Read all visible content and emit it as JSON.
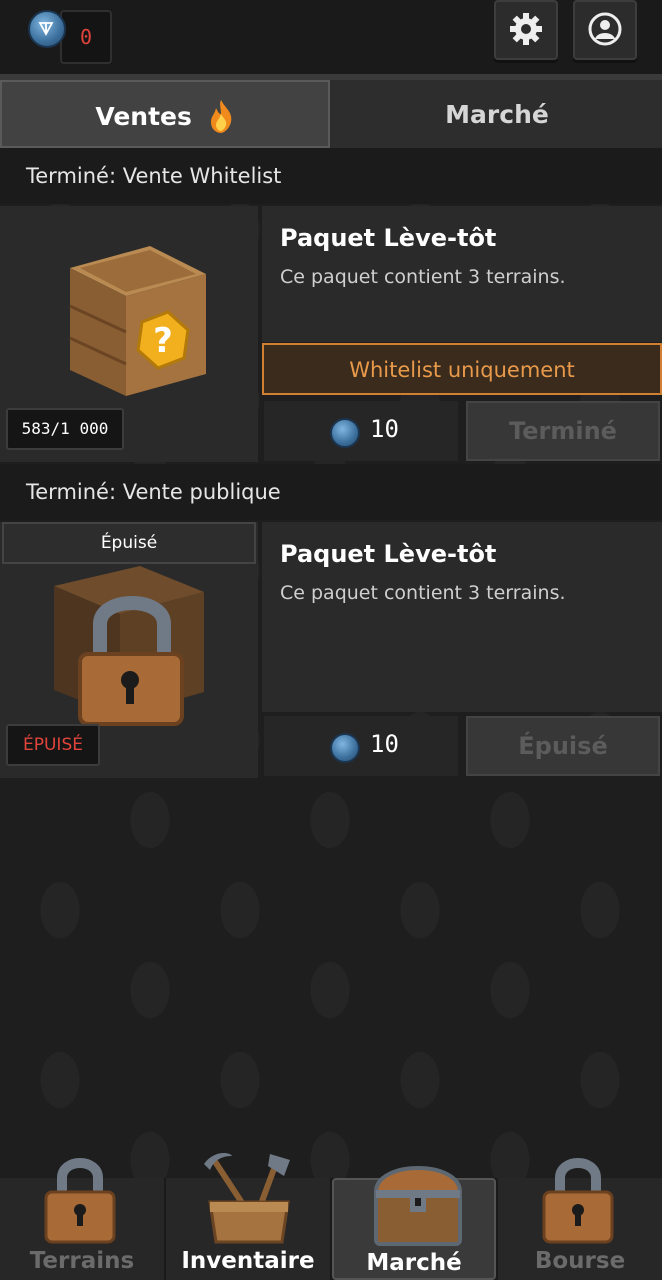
{
  "header": {
    "balance": "0",
    "settings_icon": "gear-icon",
    "profile_icon": "user-circle-icon",
    "coin_icon": "ton-coin-icon"
  },
  "tabs": [
    {
      "label": "Ventes",
      "icon": "fire-icon",
      "active": true
    },
    {
      "label": "Marché",
      "active": false
    }
  ],
  "sales": [
    {
      "section_title": "Terminé: Vente Whitelist",
      "title": "Paquet Lève-tôt",
      "description": "Ce paquet contient 3 terrains.",
      "banner": "Whitelist uniquement",
      "counter": "583/1 000",
      "price": "10",
      "button_label": "Terminé",
      "image_icon": "mystery-crate-icon"
    },
    {
      "section_title": "Terminé: Vente publique",
      "top_label": "Épuisé",
      "title": "Paquet Lève-tôt",
      "description": "Ce paquet contient 3 terrains.",
      "badge": "ÉPUISÉ",
      "price": "10",
      "button_label": "Épuisé",
      "image_icon": "locked-crate-icon"
    }
  ],
  "bottom_nav": [
    {
      "label": "Terrains",
      "icon": "padlock-icon",
      "locked": true
    },
    {
      "label": "Inventaire",
      "icon": "toolbox-icon",
      "locked": false
    },
    {
      "label": "Marché",
      "icon": "treasure-chest-icon",
      "locked": false,
      "active": true
    },
    {
      "label": "Bourse",
      "icon": "padlock-icon",
      "locked": true
    }
  ],
  "colors": {
    "accent_orange": "#d08030",
    "balance_red": "#e0443b",
    "background": "#1e1e1e"
  }
}
